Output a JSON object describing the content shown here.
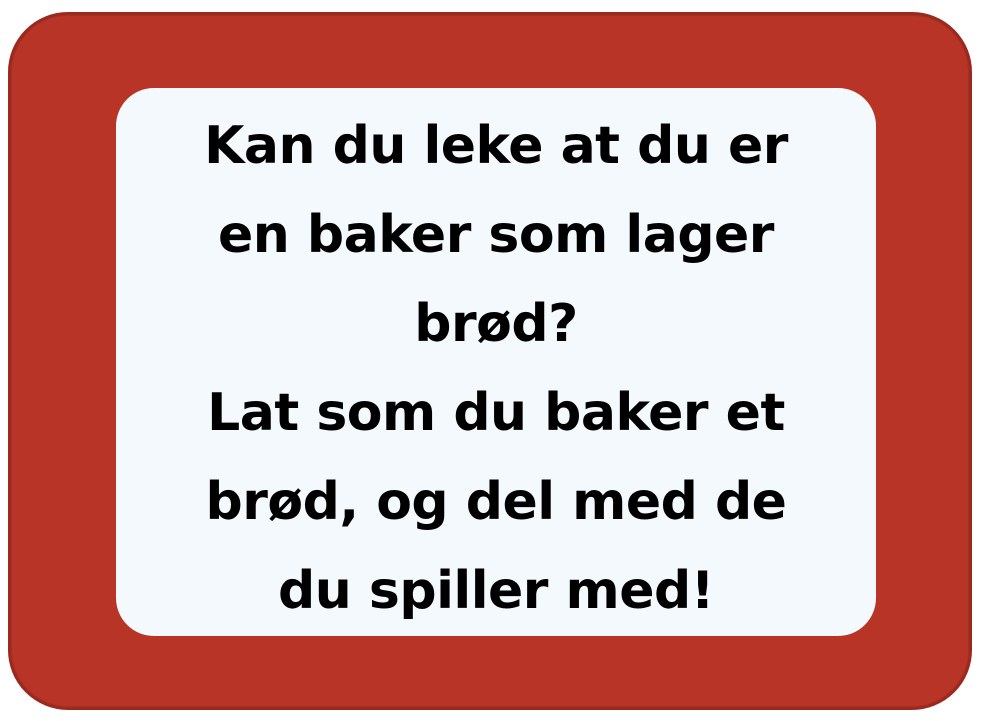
{
  "card": {
    "frame_color": "#b83426",
    "panel_color": "#f3f9fc",
    "text_color": "#000000"
  },
  "message": {
    "lines": [
      "Kan du leke at du er",
      "en baker som lager",
      "brød?",
      "Lat som du baker et",
      "brød, og del med de",
      "du spiller med!"
    ]
  }
}
